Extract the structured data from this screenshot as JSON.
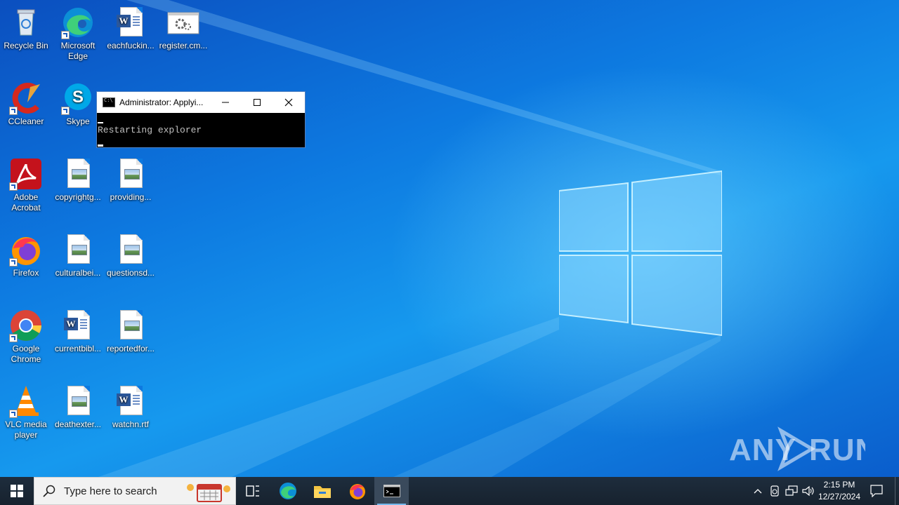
{
  "desktop": {
    "icons": [
      {
        "label": "Recycle Bin",
        "icon": "recycle-bin-icon"
      },
      {
        "label": "Microsoft Edge",
        "icon": "edge-icon"
      },
      {
        "label": "eachfuckin...",
        "icon": "word-document-icon"
      },
      {
        "label": "register.cm...",
        "icon": "batch-file-icon"
      },
      {
        "label": "CCleaner",
        "icon": "ccleaner-icon"
      },
      {
        "label": "Skype",
        "icon": "skype-icon"
      },
      {
        "label": "Adobe Acrobat",
        "icon": "acrobat-icon"
      },
      {
        "label": "copyrightg...",
        "icon": "image-file-icon"
      },
      {
        "label": "providing...",
        "icon": "image-file-icon"
      },
      {
        "label": "Firefox",
        "icon": "firefox-icon"
      },
      {
        "label": "culturalbei...",
        "icon": "image-file-icon"
      },
      {
        "label": "questionsd...",
        "icon": "image-file-icon"
      },
      {
        "label": "Google Chrome",
        "icon": "chrome-icon"
      },
      {
        "label": "currentbibl...",
        "icon": "word-document-icon"
      },
      {
        "label": "reportedfor...",
        "icon": "image-file-icon"
      },
      {
        "label": "VLC media player",
        "icon": "vlc-icon"
      },
      {
        "label": "deathexter...",
        "icon": "image-file-icon"
      },
      {
        "label": "watchn.rtf",
        "icon": "word-document-icon"
      }
    ]
  },
  "cmd_window": {
    "title": "Administrator:  Applyi...",
    "output_line": "Restarting explorer"
  },
  "watermark": {
    "text": "ANY RUN"
  },
  "taskbar": {
    "search_placeholder": "Type here to search",
    "apps": [
      "task-view",
      "edge",
      "file-explorer",
      "firefox",
      "cmd"
    ],
    "clock_time": "2:15 PM",
    "clock_date": "12/27/2024"
  },
  "colors": {
    "taskbar": "#1b2a3a",
    "accent": "#0a6fd6"
  }
}
